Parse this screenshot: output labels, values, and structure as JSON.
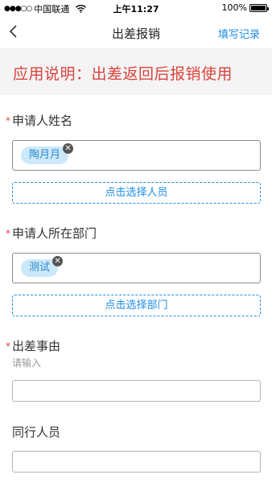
{
  "status_bar": {
    "signal": "●●●○○",
    "carrier": "中国联通",
    "time": "上午11:27",
    "battery": "100%"
  },
  "nav": {
    "title": "出差报销",
    "action_label": "填写记录"
  },
  "notice": {
    "text": "应用说明：出差返回后报销使用"
  },
  "form": {
    "applicant": {
      "required_mark": "*",
      "label": "申请人姓名",
      "tag": "陶月月",
      "button": "点击选择人员"
    },
    "department": {
      "required_mark": "*",
      "label": "申请人所在部门",
      "tag": "测试",
      "button": "点击选择部门"
    },
    "reason": {
      "required_mark": "*",
      "label": "出差事由",
      "hint": "请输入",
      "value": ""
    },
    "companions": {
      "label": "同行人员",
      "value": ""
    }
  },
  "colors": {
    "accent": "#1c8de9",
    "notice_text": "#d9433d",
    "required": "#e04545",
    "tag_bg": "#cce9fb"
  }
}
